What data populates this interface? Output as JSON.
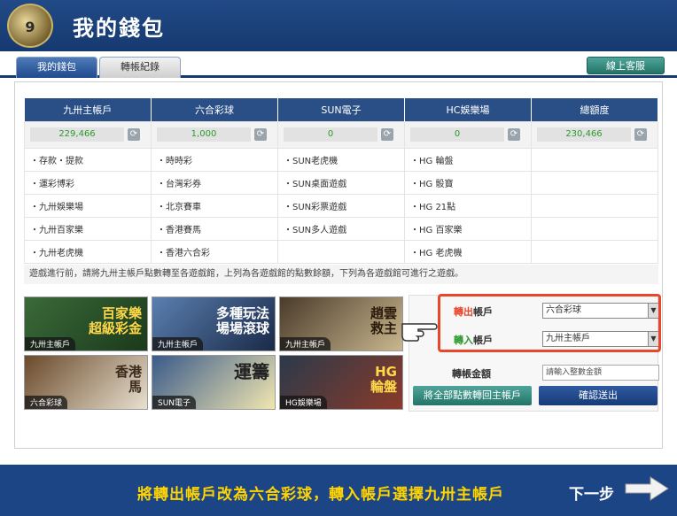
{
  "header": {
    "title": "我的錢包",
    "logo_text": "9"
  },
  "tabs": {
    "wallet": "我的錢包",
    "transfer_log": "轉帳紀錄"
  },
  "service_button": "線上客服",
  "wallet_table": {
    "headers": [
      "九卅主帳戶",
      "六合彩球",
      "SUN電子",
      "HC娛樂場",
      "總額度"
    ],
    "balances": [
      "229,466",
      "1,000",
      "0",
      "0",
      "230,466"
    ],
    "rows": [
      [
        "・存款・提款",
        "・時時彩",
        "・SUN老虎機",
        "・HG 輪盤",
        ""
      ],
      [
        "・運彩博彩",
        "・台灣彩券",
        "・SUN桌面遊戲",
        "・HG 骰寶",
        ""
      ],
      [
        "・九卅娛樂場",
        "・北京賽車",
        "・SUN彩票遊戲",
        "・HG 21點",
        ""
      ],
      [
        "・九卅百家樂",
        "・香港賽馬",
        "・SUN多人遊戲",
        "・HG 百家樂",
        ""
      ],
      [
        "・九卅老虎機",
        "・香港六合彩",
        "",
        "・HG 老虎機",
        ""
      ]
    ],
    "note": "遊戲進行前，請將九卅主帳戶點數轉至各遊戲館，上列為各遊戲館的點數餘額，下列為各遊戲館可進行之遊戲。"
  },
  "tiles": [
    {
      "big": "百家樂\n超級彩金",
      "label": "九卅主帳戶"
    },
    {
      "big": "多種玩法\n場場滾球",
      "label": "九卅主帳戶"
    },
    {
      "big": "趙雲\n救主",
      "label": "九卅主帳戶"
    },
    {
      "big": "香港\n馬",
      "label": "六合彩球"
    },
    {
      "big": "運籌",
      "label": "SUN電子"
    },
    {
      "big": "HG\n輪盤",
      "label": "HG娛樂場"
    }
  ],
  "transfer": {
    "out_label_red": "轉出",
    "out_label_rest": "帳戶",
    "out_value": "六合彩球",
    "in_label_red": "轉入",
    "in_label_rest": "帳戶",
    "in_value": "九卅主帳戶",
    "amount_label": "轉帳金額",
    "amount_placeholder": "請輸入整數金額",
    "all_button": "將全部點數轉回主帳戶",
    "confirm_button": "確認送出"
  },
  "instruction": "將轉出帳戶改為六合彩球，轉入帳戶選擇九卅主帳戶",
  "next_label": "下一步",
  "colors": {
    "header": "#1c4585",
    "accent_red": "#e8472b",
    "highlight_yellow": "#ffd400"
  }
}
